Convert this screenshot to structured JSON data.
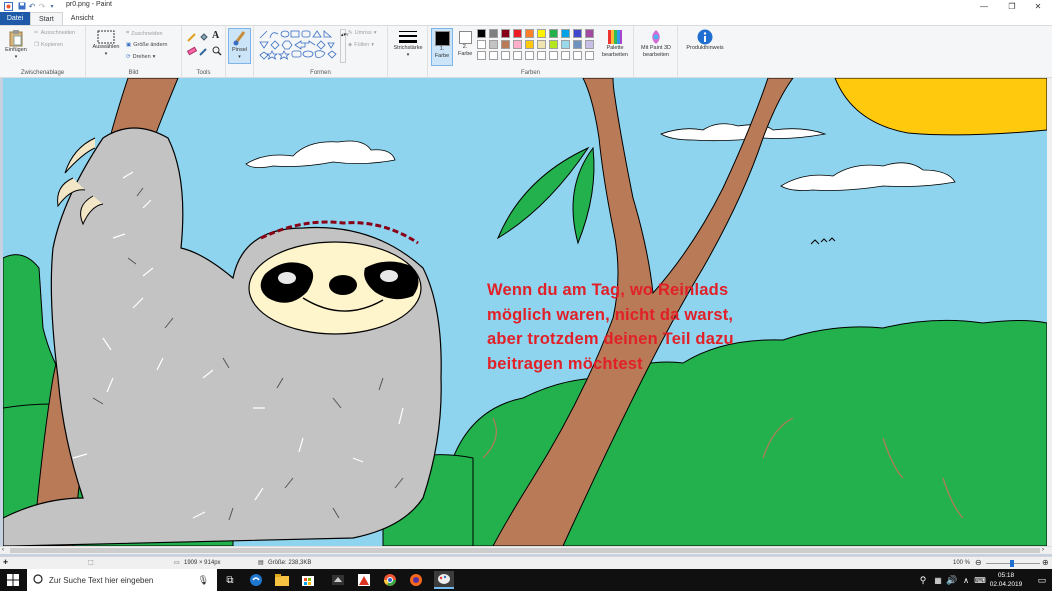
{
  "window": {
    "title": "pr0.png - Paint",
    "quick_access": [
      "save-icon",
      "undo-icon",
      "redo-icon",
      "customize-icon"
    ],
    "controls": {
      "minimize": "—",
      "maximize": "❐",
      "close": "✕"
    }
  },
  "tabs": [
    {
      "label": "Datei"
    },
    {
      "label": "Start"
    },
    {
      "label": "Ansicht"
    }
  ],
  "ribbon": {
    "clipboard": {
      "paste": "Einfügen",
      "cut": "Ausschneiden",
      "copy": "Kopieren",
      "group": "Zwischenablage"
    },
    "image": {
      "select": "Auswählen",
      "crop": "Zuschneiden",
      "resize": "Größe ändern",
      "rotate": "Drehen",
      "group": "Bild"
    },
    "tools": {
      "group": "Tools",
      "text_tool": "A"
    },
    "brushes": {
      "label": "Pinsel"
    },
    "shapes": {
      "outline": "Umriss",
      "fill": "Füllen",
      "group": "Formen"
    },
    "stroke": {
      "label": "Strichstärke"
    },
    "colors": {
      "color1": "1. Farbe",
      "color2": "2. Farbe",
      "group": "Farben",
      "color1_value": "#000000",
      "color2_value": "#ffffff",
      "palette": [
        "#000000",
        "#7f7f7f",
        "#880015",
        "#ed1c24",
        "#ff7f27",
        "#fff200",
        "#22b14c",
        "#00a2e8",
        "#3f48cc",
        "#a349a4",
        "#ffffff",
        "#c3c3c3",
        "#b97a57",
        "#ffaec9",
        "#ffc90e",
        "#efe4b0",
        "#b5e61d",
        "#99d9ea",
        "#7092be",
        "#c8bfe7",
        "#ffffff",
        "#ffffff",
        "#ffffff",
        "#ffffff",
        "#ffffff",
        "#ffffff",
        "#ffffff",
        "#ffffff",
        "#ffffff",
        "#ffffff"
      ],
      "edit_palette": "Palette bearbeiten"
    },
    "paint3d": "Mit Paint 3D bearbeiten",
    "product_alert": "Produkthinweis"
  },
  "canvas": {
    "text_lines": [
      "Wenn du am Tag, wo Reinlads",
      "möglich waren, nicht da warst,",
      "aber trotzdem deinen Teil dazu",
      "beitragen möchtest"
    ]
  },
  "status": {
    "dimensions": "1909 × 914px",
    "size": "Größe: 238,3KB",
    "zoom": "100 %"
  },
  "taskbar": {
    "search_placeholder": "Zur Suche Text hier eingeben",
    "time": "05:18",
    "date": "02.04.2019"
  }
}
